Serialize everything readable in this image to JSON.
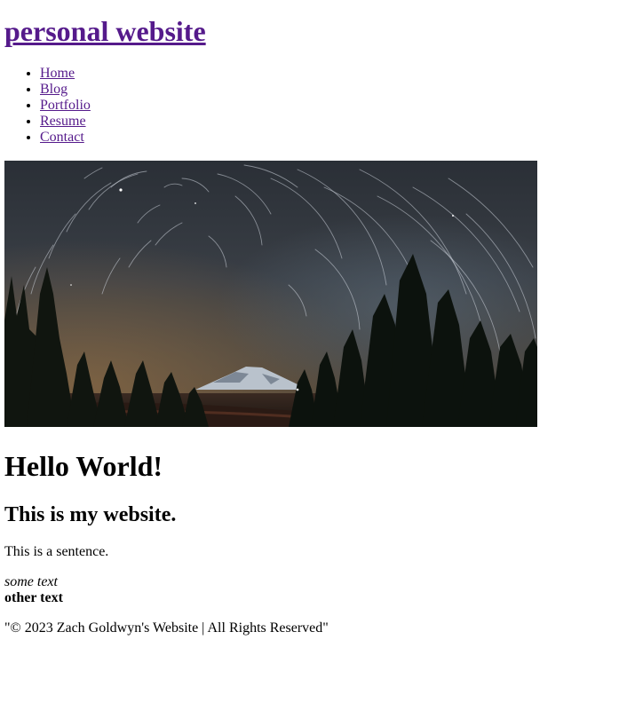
{
  "header": {
    "site_title": "personal website"
  },
  "nav": {
    "items": [
      {
        "label": "Home"
      },
      {
        "label": "Blog"
      },
      {
        "label": "Portfolio"
      },
      {
        "label": "Resume"
      },
      {
        "label": "Contact"
      }
    ]
  },
  "hero": {
    "description_icon": "night-sky-star-trails-image"
  },
  "main": {
    "heading": "Hello World!",
    "subheading": "This is my website.",
    "paragraph": "This is a sentence.",
    "italic_text": "some text",
    "bold_text": "other text"
  },
  "footer": {
    "text": "\"© 2023 Zach Goldwyn's Website | All Rights Reserved\""
  },
  "colors": {
    "link_visited": "#551a8b",
    "text": "#000000",
    "background": "#ffffff"
  }
}
